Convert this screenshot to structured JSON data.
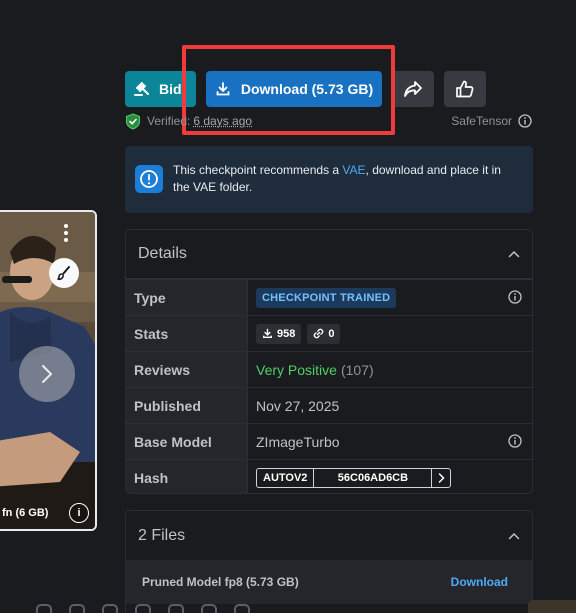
{
  "toolbar": {
    "bid_label": "Bid",
    "download_label": "Download (5.73 GB)",
    "share_icon": "share-icon",
    "like_icon": "thumbs-up-icon"
  },
  "meta": {
    "verified_label": "Verified:",
    "verified_ago": "6 days ago",
    "safetensor_label": "SafeTensor"
  },
  "alert": {
    "text_before": "This checkpoint recommends a ",
    "link": "VAE",
    "text_after": ", download and place it in the VAE folder."
  },
  "details": {
    "title": "Details",
    "type_label": "Type",
    "type_value": "CHECKPOINT TRAINED",
    "stats_label": "Stats",
    "downloads": "958",
    "links": "0",
    "reviews_label": "Reviews",
    "reviews_sentiment": "Very Positive",
    "reviews_count": "(107)",
    "published_label": "Published",
    "published_value": "Nov 27, 2025",
    "base_model_label": "Base Model",
    "base_model_value": "ZImageTurbo",
    "hash_label": "Hash",
    "hash_algo": "AUTOV2",
    "hash_value": "56C06AD6CB"
  },
  "files": {
    "title": "2 Files",
    "items": [
      {
        "name": "Pruned Model fp8 (5.73 GB)",
        "action": "Download"
      }
    ]
  },
  "image_card": {
    "caption": "fn (6 GB)"
  },
  "colors": {
    "background": "#1a1b1e",
    "bid": "#0c8599",
    "download": "#1971c2",
    "highlight": "#ef3b3b",
    "positive": "#51cf66",
    "link": "#4dabf7"
  }
}
